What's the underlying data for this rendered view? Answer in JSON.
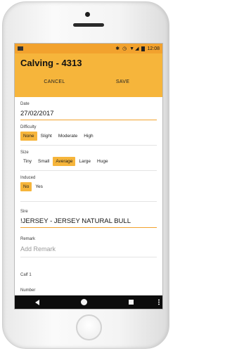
{
  "status_bar": {
    "time": "12:08",
    "icons": [
      "bluetooth-icon",
      "alarm-icon",
      "wifi-icon",
      "signal-icon",
      "battery-icon"
    ]
  },
  "header": {
    "title": "Calving - 4313",
    "cancel_label": "CANCEL",
    "save_label": "SAVE"
  },
  "form": {
    "date": {
      "label": "Date",
      "value": "27/02/2017"
    },
    "difficulty": {
      "label": "Difficulty",
      "options": [
        "None",
        "Slight",
        "Moderate",
        "High"
      ],
      "selected": "None"
    },
    "size": {
      "label": "Size",
      "options": [
        "Tiny",
        "Small",
        "Average",
        "Large",
        "Huge"
      ],
      "selected": "Average"
    },
    "induced": {
      "label": "Induced",
      "options": [
        "No",
        "Yes"
      ],
      "selected": "No"
    },
    "sire": {
      "label": "Sire",
      "value": "!JERSEY - JERSEY NATURAL BULL"
    },
    "remark": {
      "label": "Remark",
      "placeholder": "Add Remark"
    },
    "calf_section": "Calf 1",
    "number": {
      "label": "Number"
    }
  },
  "colors": {
    "accent": "#f6b53b",
    "status_bar": "#f2a22e",
    "nav_bar": "#0c0c0c"
  }
}
